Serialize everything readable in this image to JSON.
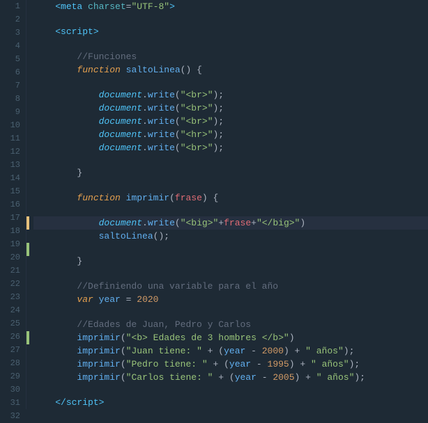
{
  "editor": {
    "lines": [
      {
        "num": 1,
        "content": "meta"
      },
      {
        "num": 2,
        "content": ""
      },
      {
        "num": 3,
        "content": "script_open"
      },
      {
        "num": 4,
        "content": ""
      },
      {
        "num": 5,
        "content": "comment_funciones"
      },
      {
        "num": 6,
        "content": "func_saltoLinea"
      },
      {
        "num": 7,
        "content": ""
      },
      {
        "num": 8,
        "content": "doc_write_br1"
      },
      {
        "num": 9,
        "content": "doc_write_br2"
      },
      {
        "num": 10,
        "content": "doc_write_br3"
      },
      {
        "num": 11,
        "content": "doc_write_hr"
      },
      {
        "num": 12,
        "content": "doc_write_br4"
      },
      {
        "num": 13,
        "content": ""
      },
      {
        "num": 14,
        "content": "close_brace"
      },
      {
        "num": 15,
        "content": ""
      },
      {
        "num": 16,
        "content": "func_imprimir"
      },
      {
        "num": 17,
        "content": ""
      },
      {
        "num": 18,
        "content": "doc_write_big"
      },
      {
        "num": 19,
        "content": "saltoLinea_call"
      },
      {
        "num": 20,
        "content": ""
      },
      {
        "num": 21,
        "content": "close_brace2"
      },
      {
        "num": 22,
        "content": ""
      },
      {
        "num": 23,
        "content": "comment_variable"
      },
      {
        "num": 24,
        "content": "var_year"
      },
      {
        "num": 25,
        "content": ""
      },
      {
        "num": 26,
        "content": "comment_edades"
      },
      {
        "num": 27,
        "content": "imprimir_edades"
      },
      {
        "num": 28,
        "content": "imprimir_juan"
      },
      {
        "num": 29,
        "content": "imprimir_pedro"
      },
      {
        "num": 30,
        "content": "imprimir_carlos"
      },
      {
        "num": 31,
        "content": ""
      },
      {
        "num": 32,
        "content": "script_close"
      }
    ]
  }
}
